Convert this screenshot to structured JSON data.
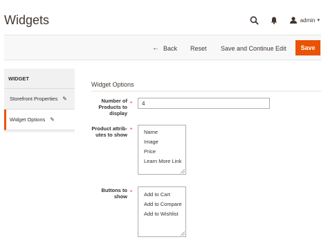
{
  "header": {
    "title": "Widgets",
    "user_label": "admin",
    "icons": [
      "search-icon",
      "bell-icon",
      "user-icon",
      "caret-down-icon"
    ]
  },
  "toolbar": {
    "back_label": "Back",
    "reset_label": "Reset",
    "save_continue_label": "Save and Continue Edit",
    "save_label": "Save",
    "accent_color": "#eb5202"
  },
  "sidebar": {
    "title": "WIDGET",
    "items": [
      {
        "label": "Storefront Properties",
        "active": false
      },
      {
        "label": "Widget Options",
        "active": true
      }
    ]
  },
  "main": {
    "section_title": "Widget Options",
    "fields": {
      "num_products": {
        "label_line1": "Number of",
        "label_line2": "Products to",
        "label_line3": "display",
        "value": "4"
      },
      "product_attributes": {
        "label_line1": "Product attrib-",
        "label_line2": "utes to show",
        "options": [
          "Name",
          "Image",
          "Price",
          "Learn More Link"
        ]
      },
      "buttons_to_show": {
        "label_line1": "Buttons to",
        "label_line2": "show",
        "options": [
          "Add to Cart",
          "Add to Compare",
          "Add to Wishlist"
        ]
      }
    },
    "required_marker": "*"
  }
}
